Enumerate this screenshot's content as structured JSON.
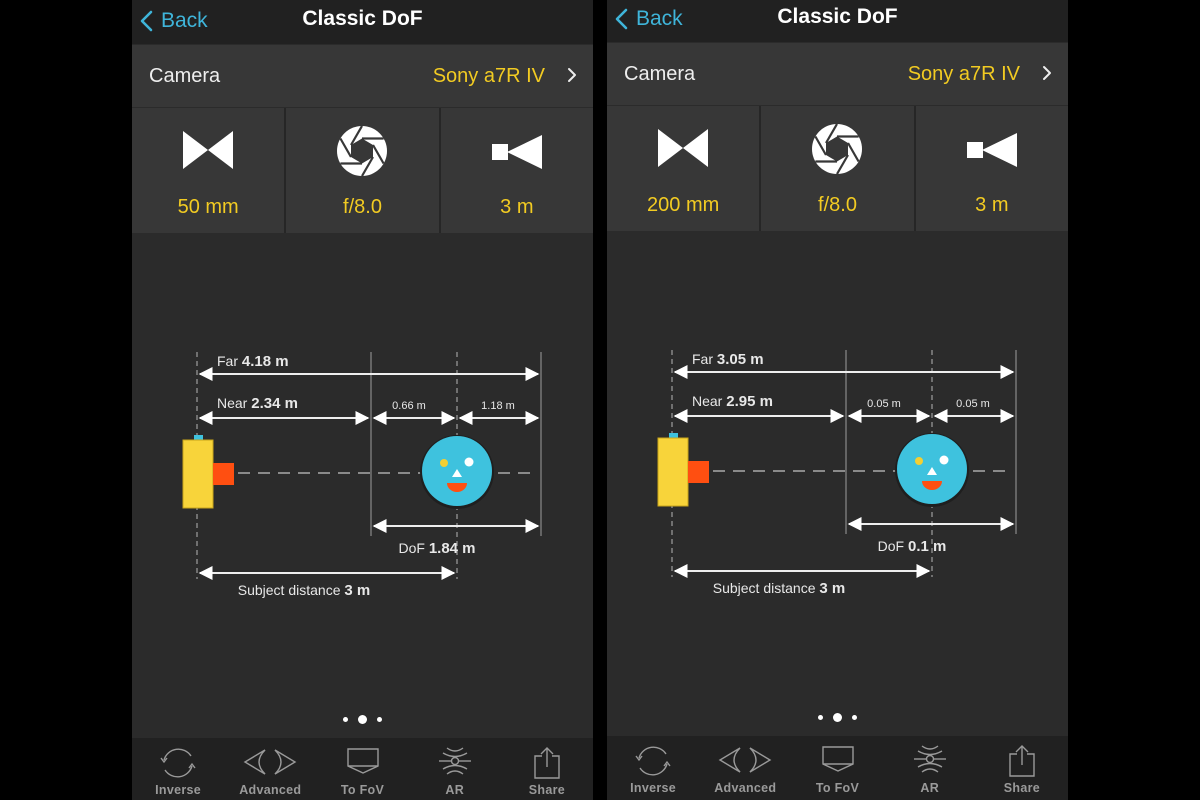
{
  "colors": {
    "accent_blue": "#3fb5da",
    "value_yellow": "#f2cb22",
    "background": "#2b2b2b"
  },
  "panels": [
    {
      "nav": {
        "back_label": "Back",
        "title": "Classic DoF"
      },
      "camera": {
        "label": "Camera",
        "value": "Sony a7R IV"
      },
      "tiles": [
        {
          "icon": "focal-length-icon",
          "value": "50 mm"
        },
        {
          "icon": "aperture-icon",
          "value": "f/8.0"
        },
        {
          "icon": "subject-distance-icon",
          "value": "3 m"
        }
      ],
      "diagram": {
        "far_label": "Far",
        "far_value": "4.18 m",
        "near_label": "Near",
        "near_value": "2.34 m",
        "front_dof": "0.66 m",
        "rear_dof": "1.18 m",
        "dof_label": "DoF",
        "dof_value": "1.84 m",
        "subject_label": "Subject distance",
        "subject_value": "3 m"
      },
      "page_dots": {
        "count": 3,
        "active": 1
      },
      "tabbar": [
        {
          "icon": "inverse-icon",
          "label": "Inverse"
        },
        {
          "icon": "advanced-icon",
          "label": "Advanced"
        },
        {
          "icon": "to-fov-icon",
          "label": "To FoV"
        },
        {
          "icon": "ar-icon",
          "label": "AR"
        },
        {
          "icon": "share-icon",
          "label": "Share"
        }
      ]
    },
    {
      "nav": {
        "back_label": "Back",
        "title": "Classic DoF"
      },
      "camera": {
        "label": "Camera",
        "value": "Sony a7R IV"
      },
      "tiles": [
        {
          "icon": "focal-length-icon",
          "value": "200 mm"
        },
        {
          "icon": "aperture-icon",
          "value": "f/8.0"
        },
        {
          "icon": "subject-distance-icon",
          "value": "3 m"
        }
      ],
      "diagram": {
        "far_label": "Far",
        "far_value": "3.05 m",
        "near_label": "Near",
        "near_value": "2.95 m",
        "front_dof": "0.05 m",
        "rear_dof": "0.05 m",
        "dof_label": "DoF",
        "dof_value": "0.1 m",
        "subject_label": "Subject distance",
        "subject_value": "3 m"
      },
      "page_dots": {
        "count": 3,
        "active": 1
      },
      "tabbar": [
        {
          "icon": "inverse-icon",
          "label": "Inverse"
        },
        {
          "icon": "advanced-icon",
          "label": "Advanced"
        },
        {
          "icon": "to-fov-icon",
          "label": "To FoV"
        },
        {
          "icon": "ar-icon",
          "label": "AR"
        },
        {
          "icon": "share-icon",
          "label": "Share"
        }
      ]
    }
  ]
}
